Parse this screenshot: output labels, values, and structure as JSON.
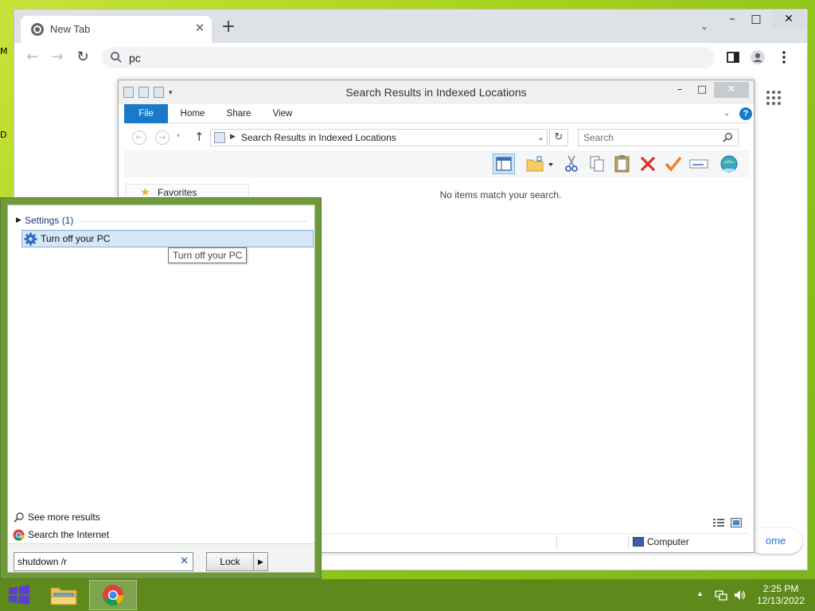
{
  "chrome": {
    "tab_title": "New Tab",
    "tab_close_glyph": "✕",
    "new_tab_glyph": "+",
    "tab_search_glyph": "⌄",
    "minimize_glyph": "–",
    "maximize_glyph": "□",
    "close_glyph": "✕",
    "back_glyph": "←",
    "forward_glyph": "→",
    "reload_glyph": "↻",
    "omnibox_value": "pc",
    "customize_label": "ome",
    "icons": [
      "chrome-logo-icon",
      "search-icon",
      "side-panel-icon",
      "profile-icon",
      "menu-kebab-icon",
      "apps-grid-icon"
    ]
  },
  "explorer": {
    "title": "Search Results in Indexed Locations",
    "minimize_glyph": "–",
    "maximize_glyph": "□",
    "close_glyph": "✕",
    "ribbon_tabs": [
      "File",
      "Home",
      "Share",
      "View"
    ],
    "ribbon_chevron_glyph": "⌄",
    "help_glyph": "?",
    "address_crumb": "Search Results in Indexed Locations",
    "address_dropdown_glyph": "⌄",
    "back_glyph": "←",
    "forward_glyph": "→",
    "up_glyph": "↑",
    "refresh_glyph": "↻",
    "search_placeholder": "Search",
    "nav_favorites": "Favorites",
    "empty_message": "No items match your search.",
    "status_location": "Computer",
    "toolbar_icons": [
      "preview-pane-icon",
      "new-folder-icon",
      "cut-icon",
      "copy-icon",
      "paste-icon",
      "delete-icon",
      "properties-check-icon",
      "rename-icon",
      "globe-icon"
    ],
    "accent_color": "#1979ca"
  },
  "flyout": {
    "group_label": "Settings (1)",
    "result_label": "Turn off your PC",
    "tooltip": "Turn off your PC",
    "see_more": "See more results",
    "search_internet": "Search the Internet",
    "search_value": "shutdown /r",
    "clear_glyph": "✕",
    "power_button_label": "Lock",
    "frame_color": "#6f9a3a"
  },
  "taskbar": {
    "time": "2:25 PM",
    "date": "12/13/2022",
    "color": "#5d8a1b",
    "pinned": [
      "file-explorer-icon",
      "chrome-icon"
    ],
    "tray_icons": [
      "network-icon",
      "volume-icon"
    ]
  }
}
